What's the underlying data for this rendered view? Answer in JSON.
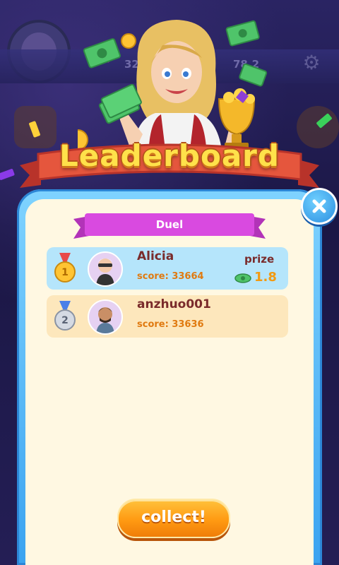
{
  "background": {
    "stat_left": "32",
    "stat_right": "78.2"
  },
  "title": "Leaderboard",
  "tab": {
    "label": "Duel"
  },
  "leaderboard": [
    {
      "rank": "1",
      "name": "Alicia",
      "score": "score: 33664",
      "prize_label": "prize",
      "prize_value": "1.8"
    },
    {
      "rank": "2",
      "name": "anzhuo001",
      "score": "score: 33636"
    }
  ],
  "collect_label": "collect!",
  "colors": {
    "ribbon": "#e5563d",
    "duel_tab": "#d94ae0",
    "row_highlight": "#b5e5fb",
    "row_second": "#fde7bc",
    "button": "#ff9a12"
  }
}
